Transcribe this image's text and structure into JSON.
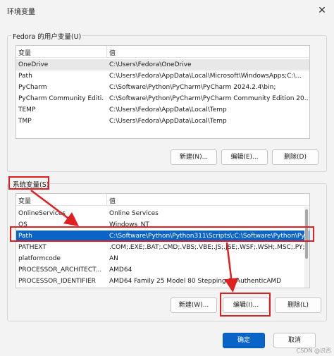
{
  "window": {
    "title": "环境变量",
    "close_glyph": "✕"
  },
  "user_section": {
    "label": "Fedora 的用户变量(U)",
    "columns": [
      "变量",
      "值"
    ],
    "rows": [
      {
        "name": "OneDrive",
        "value": "C:\\Users\\Fedora\\OneDrive"
      },
      {
        "name": "Path",
        "value": "C:\\Users\\Fedora\\AppData\\Local\\Microsoft\\WindowsApps;C:\\..."
      },
      {
        "name": "PyCharm",
        "value": "C:\\Software\\Python\\PyCharm\\PyCharm 2024.2.4\\bin;"
      },
      {
        "name": "PyCharm Community Editi...",
        "value": "C:\\Software\\Python\\PyCharm\\PyCharm Community Edition 20..."
      },
      {
        "name": "TEMP",
        "value": "C:\\Users\\Fedora\\AppData\\Local\\Temp"
      },
      {
        "name": "TMP",
        "value": "C:\\Users\\Fedora\\AppData\\Local\\Temp"
      }
    ],
    "buttons": {
      "new": "新建(N)...",
      "edit": "编辑(E)...",
      "delete": "删除(D)"
    }
  },
  "system_section": {
    "label": "系统变量(S)",
    "columns": [
      "变量",
      "值"
    ],
    "rows": [
      {
        "name": "OnlineServices",
        "value": "Online Services"
      },
      {
        "name": "OS",
        "value": "Windows_NT"
      },
      {
        "name": "Path",
        "value": "C:\\Software\\Python\\Python311\\Scripts\\;C:\\Software\\Python\\Py..."
      },
      {
        "name": "PATHEXT",
        "value": ".COM;.EXE;.BAT;.CMD;.VBS;.VBE;.JS;.JSE;.WSF;.WSH;.MSC;.PY;.P..."
      },
      {
        "name": "platformcode",
        "value": "AN"
      },
      {
        "name": "PROCESSOR_ARCHITECT...",
        "value": "AMD64"
      },
      {
        "name": "PROCESSOR_IDENTIFIER",
        "value": "AMD64 Family 25 Model 80 Stepping 0, AuthenticAMD"
      }
    ],
    "buttons": {
      "new": "新建(W)...",
      "edit": "编辑(I)...",
      "delete": "删除(L)"
    }
  },
  "footer": {
    "ok": "确定",
    "cancel": "取消"
  },
  "watermark": "CSDN @识否"
}
